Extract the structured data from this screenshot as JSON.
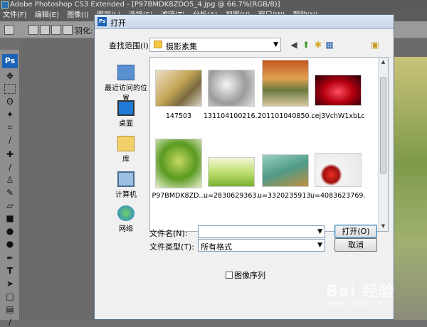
{
  "app": {
    "title": "Adobe Photoshop CS3 Extended - [P97BMDK8ZDO5_4.jpg @ 66.7%(RGB/8)]",
    "menu": [
      "文件(F)",
      "编辑(E)",
      "图像(I)",
      "图层(L)",
      "选择(S)",
      "滤镜(T)",
      "分析(A)",
      "视图(V)",
      "窗口(W)",
      "帮助(H)"
    ],
    "options": {
      "feather_label": "羽化:"
    },
    "logo": "Ps"
  },
  "dialog": {
    "title": "打开",
    "look_in_label": "查找范围(I):",
    "look_in_value": "摄影素集",
    "places": [
      {
        "label": "最近访问的位置",
        "icon": "recent-places-icon"
      },
      {
        "label": "桌面",
        "icon": "desktop-icon"
      },
      {
        "label": "库",
        "icon": "libraries-icon"
      },
      {
        "label": "计算机",
        "icon": "computer-icon"
      },
      {
        "label": "网络",
        "icon": "network-icon"
      }
    ],
    "files": [
      {
        "name": "147503"
      },
      {
        "name": "131104100216..."
      },
      {
        "name": "201101040850..."
      },
      {
        "name": "cej3VchW1xbLc"
      },
      {
        "name": "P97BMDK8ZD..."
      },
      {
        "name": "u=2830629363..."
      },
      {
        "name": "u=3320235913..."
      },
      {
        "name": "u=4083623769..."
      }
    ],
    "filename_label": "文件名(N):",
    "filename_value": "",
    "filetype_label": "文件类型(T):",
    "filetype_value": "所有格式",
    "open_button": "打开(O)",
    "cancel_button": "取消",
    "image_sequence_label": "图像序列"
  },
  "watermark": {
    "text": "Bai 经验",
    "sub": "jingyan.baidu.com"
  }
}
